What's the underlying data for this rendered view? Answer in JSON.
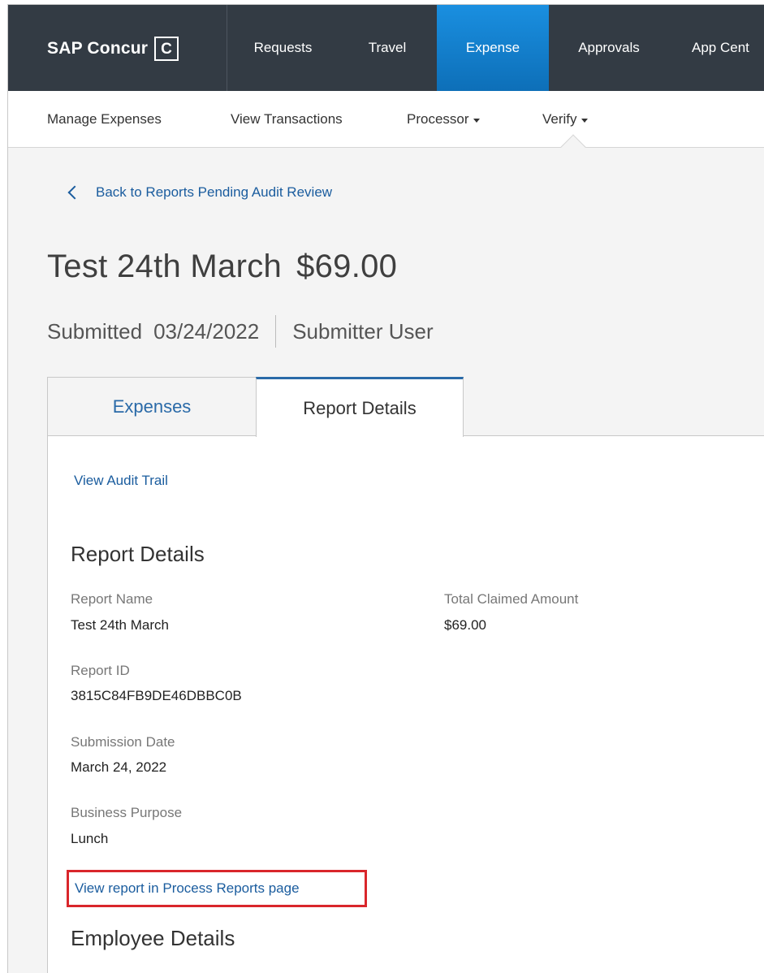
{
  "brand": {
    "name": "SAP Concur",
    "mark": "C"
  },
  "topnav": {
    "items": [
      {
        "label": "Requests"
      },
      {
        "label": "Travel"
      },
      {
        "label": "Expense",
        "active": true
      },
      {
        "label": "Approvals"
      },
      {
        "label": "App Cent"
      }
    ],
    "active_color": "#1a8fe0"
  },
  "subnav": {
    "items": [
      {
        "label": "Manage Expenses"
      },
      {
        "label": "View Transactions"
      },
      {
        "label": "Processor"
      },
      {
        "label": "Verify"
      }
    ]
  },
  "back_link": {
    "label": "Back to Reports Pending Audit Review",
    "icon": "chevron-left-icon"
  },
  "report": {
    "title": "Test 24th March",
    "amount": "$69.00",
    "status": "Submitted",
    "submitted_date": "03/24/2022",
    "submitter": "Submitter User"
  },
  "tabs": [
    {
      "label": "Expenses",
      "active": false
    },
    {
      "label": "Report Details",
      "active": true
    }
  ],
  "details": {
    "audit_trail_link": "View Audit Trail",
    "section_title": "Report Details",
    "fields": {
      "report_name": {
        "label": "Report Name",
        "value": "Test 24th March"
      },
      "total_claimed": {
        "label": "Total Claimed Amount",
        "value": "$69.00"
      },
      "report_id": {
        "label": "Report ID",
        "value": "3815C84FB9DE46DBBC0B"
      },
      "submission_date": {
        "label": "Submission Date",
        "value": "March 24, 2022"
      },
      "business_purpose": {
        "label": "Business Purpose",
        "value": "Lunch"
      }
    },
    "process_reports_link": "View report in Process Reports page",
    "employee_section_title": "Employee Details"
  },
  "colors": {
    "link": "#1a5c9e",
    "highlight": "#d9262b",
    "header": "#333b44"
  }
}
